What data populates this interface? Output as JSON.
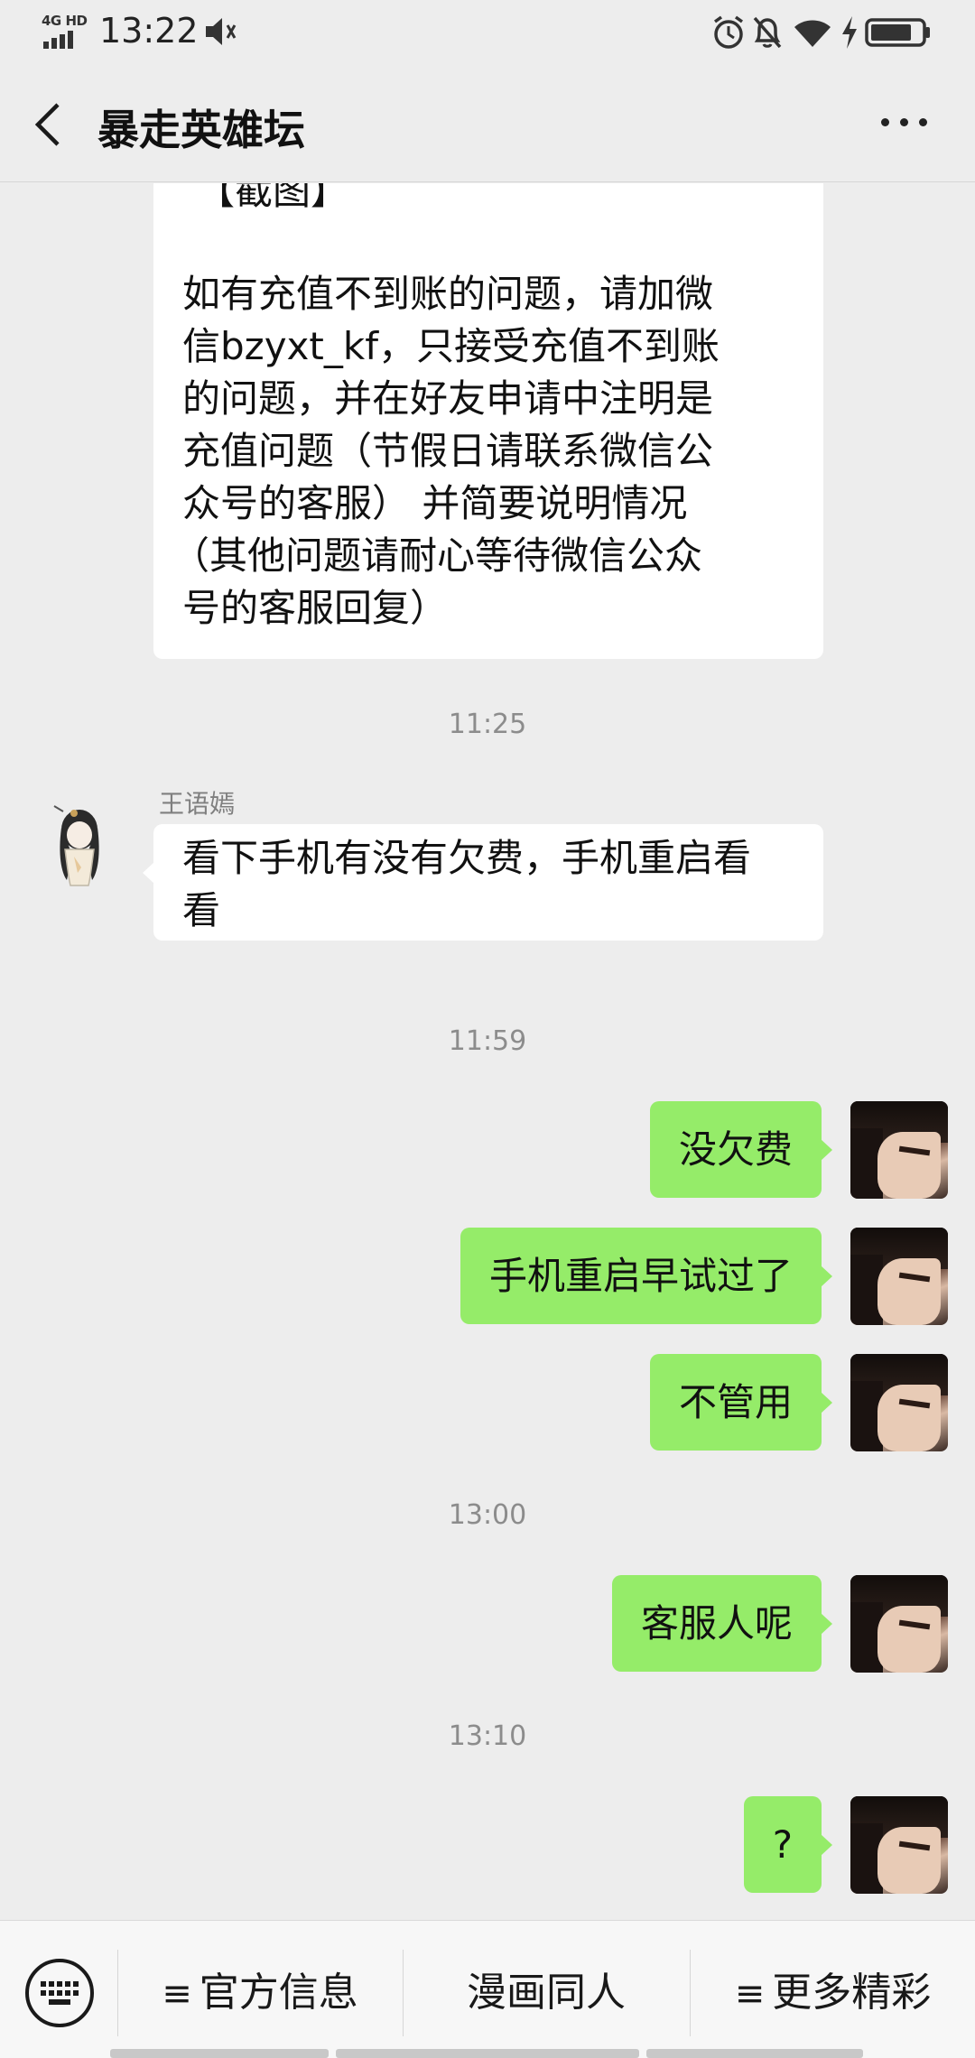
{
  "status_bar": {
    "network": "4G HD",
    "time": "13:22",
    "icons": [
      "speaker-mute-icon",
      "alarm-icon",
      "bell-off-icon",
      "wifi-icon",
      "charging-icon",
      "battery-icon"
    ]
  },
  "header": {
    "title": "暴走英雄坛",
    "back_icon": "chevron-left-icon",
    "more_icon": "more-dots-icon"
  },
  "messages": {
    "partial_top": {
      "line0": "【截图】",
      "lines": [
        "如有充值不到账的问题，请加微",
        "信bzyxt_kf，只接受充值不到账",
        "的问题，并在好友申请中注明是",
        "充值问题（节假日请联系微信公",
        "众号的客服） 并简要说明情况",
        "（其他问题请耐心等待微信公众",
        "号的客服回复）"
      ]
    },
    "ts1": "11:25",
    "m1": {
      "sender": "王语嫣",
      "line1": "看下手机有没有欠费，手机重启看",
      "line2": "看"
    },
    "ts2": "11:59",
    "m2": "没欠费",
    "m3": "手机重启早试过了",
    "m4": "不管用",
    "ts3": "13:00",
    "m5": "客服人呢",
    "ts4": "13:10",
    "m6": "?"
  },
  "bottom_menu": {
    "keyboard_icon": "keyboard-icon",
    "items": [
      "官方信息",
      "漫画同人",
      "更多精彩"
    ],
    "list_glyph": "≡"
  },
  "colors": {
    "background": "#ededed",
    "bubble_out": "#95ec69",
    "bubble_in": "#ffffff",
    "timestamp": "#8c8c8c"
  }
}
